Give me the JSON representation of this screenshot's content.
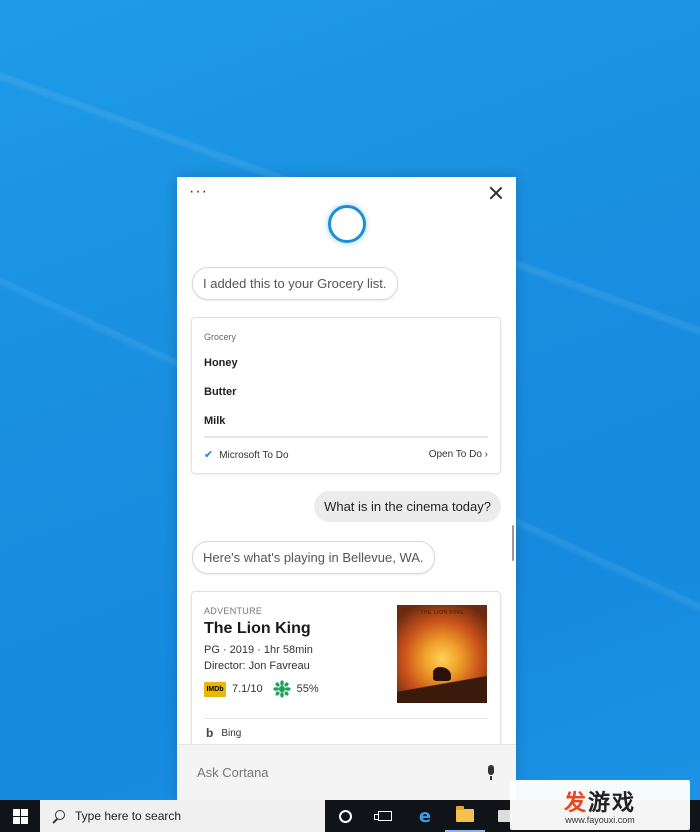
{
  "cortana": {
    "more_label": "···",
    "greeting_bubble": "I added this to your Grocery list.",
    "grocery_card": {
      "caption": "Grocery",
      "items": [
        "Honey",
        "Butter",
        "Milk"
      ],
      "source_label": "Microsoft To Do",
      "open_link": "Open To Do ›"
    },
    "user_query": "What is in the cinema today?",
    "response_bubble": "Here's what's playing in Bellevue, WA.",
    "movie_card": {
      "genre": "ADVENTURE",
      "title": "The Lion King",
      "meta": "PG · 2019 · 1hr 58min",
      "director": "Director: Jon Favreau",
      "imdb_badge": "IMDb",
      "imdb_rating": "7.1/10",
      "rt_score": "55%",
      "poster_text": "THE LION KING",
      "source": "Bing"
    },
    "ask_placeholder": "Ask Cortana"
  },
  "taskbar": {
    "search_placeholder": "Type here to search"
  },
  "watermark": {
    "logo_part1": "发",
    "logo_part2": "游戏",
    "url": "www.fayouxi.com"
  },
  "colors": {
    "desktop": "#1a8fe0",
    "cortana_accent": "#1a8fd8",
    "taskbar": "#101418",
    "imdb": "#e8b708",
    "watermark_red": "#e8461e"
  }
}
